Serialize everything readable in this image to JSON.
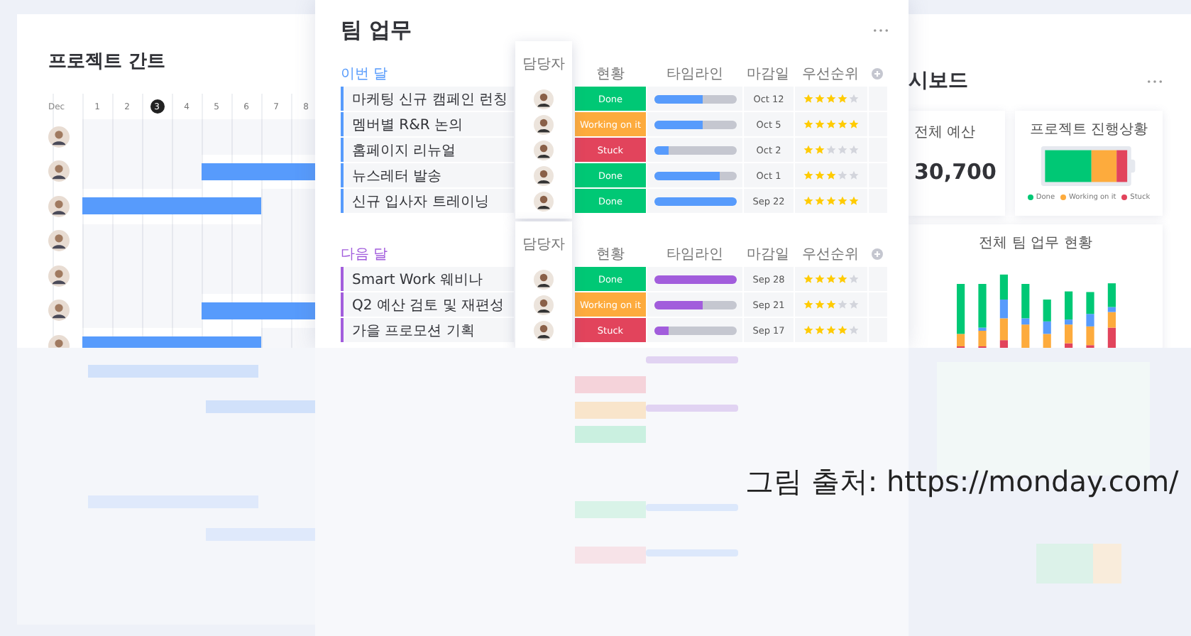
{
  "gantt": {
    "title": "프로젝트 간트",
    "month": "Dec",
    "days": [
      {
        "label": "1",
        "selected": false
      },
      {
        "label": "2",
        "selected": false
      },
      {
        "label": "3",
        "selected": true
      },
      {
        "label": "4",
        "selected": false
      },
      {
        "label": "5",
        "selected": false
      },
      {
        "label": "6",
        "selected": false
      },
      {
        "label": "7",
        "selected": false
      },
      {
        "label": "8",
        "selected": false
      }
    ],
    "rows": [
      {
        "busy": [
          false,
          false,
          false,
          false,
          false,
          false,
          false,
          false
        ]
      },
      {
        "busy": [
          false,
          false,
          false,
          false,
          true,
          true,
          true,
          true
        ]
      },
      {
        "busy": [
          true,
          true,
          true,
          true,
          true,
          true,
          false,
          false
        ]
      },
      {
        "busy": [
          false,
          false,
          false,
          false,
          false,
          false,
          false,
          false
        ]
      },
      {
        "busy": [
          false,
          false,
          false,
          false,
          false,
          false,
          false,
          false
        ]
      },
      {
        "busy": [
          false,
          false,
          false,
          false,
          true,
          true,
          true,
          true
        ]
      },
      {
        "busy": [
          true,
          true,
          true,
          true,
          true,
          true,
          false,
          false
        ]
      }
    ]
  },
  "tasks": {
    "title": "팀 업무",
    "groups": [
      {
        "title": "이번 달",
        "color": "#579bfc",
        "owner_label": "담당자",
        "columns": [
          "현황",
          "타임라인",
          "마감일",
          "우선순위"
        ],
        "rows": [
          {
            "name": "마케팅 신규 캠페인 런칭",
            "status": "Done",
            "color": "#00c875",
            "level": 0.6,
            "due": "Oct 12",
            "stars": 4
          },
          {
            "name": "멤버별 R&R 논의",
            "status": "Working on it",
            "color": "#fdab3d",
            "level": 0.6,
            "due": "Oct 5",
            "stars": 5
          },
          {
            "name": "홈페이지 리뉴얼",
            "status": "Stuck",
            "color": "#e2445c",
            "level": 0.18,
            "due": "Oct 2",
            "stars": 2
          },
          {
            "name": "뉴스레터 발송",
            "status": "Done",
            "color": "#00c875",
            "level": 0.8,
            "due": "Oct 1",
            "stars": 3
          },
          {
            "name": "신규 입사자 트레이닝",
            "status": "Done",
            "color": "#00c875",
            "level": 1,
            "due": "Sep 22",
            "stars": 5
          }
        ]
      },
      {
        "title": "다음 달",
        "color": "#a25ddc",
        "owner_label": "담당자",
        "columns": [
          "현황",
          "타임라인",
          "마감일",
          "우선순위"
        ],
        "rows": [
          {
            "name": "Smart Work 웨비나",
            "status": "Done",
            "color": "#00c875",
            "level": 1,
            "due": "Sep 28",
            "stars": 4
          },
          {
            "name": "Q2 예산 검토 및 재편성",
            "status": "Working on it",
            "color": "#fdab3d",
            "level": 0.6,
            "due": "Sep 21",
            "stars": 3
          },
          {
            "name": "가을 프로모션 기획",
            "status": "Stuck",
            "color": "#e2445c",
            "level": 0.18,
            "due": "Sep 17",
            "stars": 4
          }
        ]
      }
    ]
  },
  "dashboard": {
    "title": "시보드",
    "budget_label": "전체 예산",
    "budget_value": "30,700",
    "progress_title": "프로젝트 진행상황",
    "legend": [
      {
        "label": "Done",
        "color": "#00c875"
      },
      {
        "label": "Working on it",
        "color": "#fdab3d"
      },
      {
        "label": "Stuck",
        "color": "#e2445c"
      }
    ],
    "chart_title": "전체 팀 업무 현황"
  },
  "caption": "그림 출처: https://monday.com/"
}
